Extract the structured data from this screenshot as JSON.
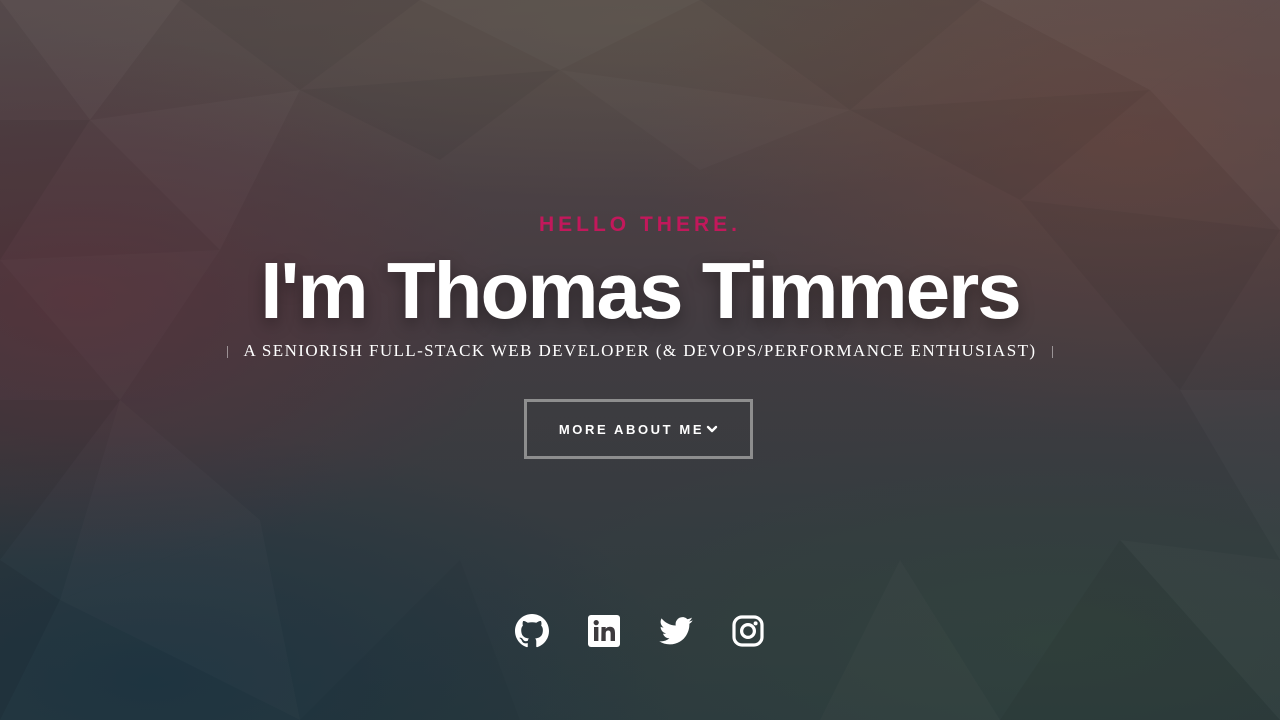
{
  "hero": {
    "greeting": "HELLO THERE.",
    "name": "I'm Thomas Timmers",
    "subtitle": "A SENIORISH FULL-STACK WEB DEVELOPER (& DEVOPS/PERFORMANCE ENTHUSIAST)",
    "cta_label": "MORE ABOUT ME",
    "cta_icon": "chevron-down-icon"
  },
  "socials": [
    {
      "icon": "github-icon"
    },
    {
      "icon": "linkedin-icon"
    },
    {
      "icon": "twitter-icon"
    },
    {
      "icon": "instagram-icon"
    }
  ],
  "colors": {
    "accent": "#c2185b",
    "text": "#ffffff",
    "button_border": "#aaaaaa"
  }
}
